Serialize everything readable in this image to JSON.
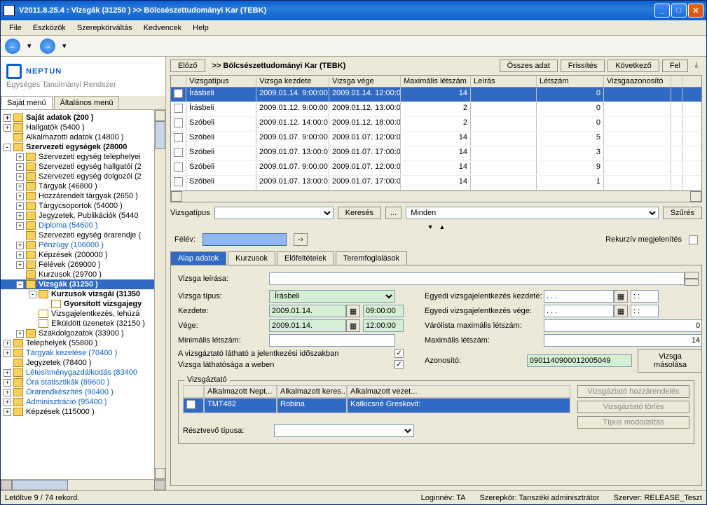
{
  "title": "V2011.8.25.4 : Vizsgák (31250  )   >> Bölcsészettudományi Kar (TEBK)",
  "menu": [
    "File",
    "Eszközök",
    "Szerepkörváltás",
    "Kedvencek",
    "Help"
  ],
  "logo": {
    "brand": "NEPTUN",
    "sub": "Egységes Tanulmányi Rendszer"
  },
  "left_tabs": {
    "active": "Saját menü",
    "other": "Általános menü"
  },
  "tree": [
    {
      "l": 1,
      "exp": "+",
      "bold": true,
      "t": "Saját adatok (200  )"
    },
    {
      "l": 1,
      "exp": "+",
      "t": "Hallgatók (5400  )"
    },
    {
      "l": 1,
      "exp": " ",
      "t": "Alkalmazotti adatok (14800  )"
    },
    {
      "l": 1,
      "exp": "-",
      "bold": true,
      "t": "Szervezeti egységek (28000"
    },
    {
      "l": 2,
      "exp": "+",
      "t": "Szervezeti egység telephelyei"
    },
    {
      "l": 2,
      "exp": "+",
      "t": "Szervezeti egység hallgatói (2"
    },
    {
      "l": 2,
      "exp": "+",
      "t": "Szervezeti egység dolgozói (2"
    },
    {
      "l": 2,
      "exp": "+",
      "t": "Tárgyak (46800  )"
    },
    {
      "l": 2,
      "exp": "+",
      "t": "Hozzárendelt tárgyak (2650  )"
    },
    {
      "l": 2,
      "exp": "+",
      "t": "Tárgycsoportok (54000  )"
    },
    {
      "l": 2,
      "exp": "+",
      "t": "Jegyzetek, Publikációk (5440"
    },
    {
      "l": 2,
      "exp": "+",
      "blue": true,
      "t": "Diploma (54600  )"
    },
    {
      "l": 2,
      "exp": " ",
      "t": "Szervezeti egység órarendje ("
    },
    {
      "l": 2,
      "exp": "+",
      "blue": true,
      "t": "Pénzügy (106000  )"
    },
    {
      "l": 2,
      "exp": "+",
      "t": "Képzések (200000  )"
    },
    {
      "l": 2,
      "exp": "+",
      "t": "Félévek (269000  )"
    },
    {
      "l": 2,
      "exp": " ",
      "t": "Kurzusok (29700  )"
    },
    {
      "l": 2,
      "exp": "-",
      "sel": true,
      "bold": true,
      "t": "Vizsgák (31250  )"
    },
    {
      "l": 3,
      "exp": "-",
      "bold": true,
      "t": "Kurzusok vizsgái (31350"
    },
    {
      "l": 4,
      "exp": " ",
      "bold": true,
      "doc": true,
      "t": "Gyorsított vizsgajegy"
    },
    {
      "l": 3,
      "exp": " ",
      "doc": true,
      "t": "Vizsgajelentkezés, lehúzá"
    },
    {
      "l": 3,
      "exp": " ",
      "doc": true,
      "t": "Elküldött üzenetek (32150  )"
    },
    {
      "l": 2,
      "exp": "+",
      "t": "Szakdolgozatok (33900  )"
    },
    {
      "l": 1,
      "exp": "+",
      "t": "Telephelyek (55800  )"
    },
    {
      "l": 1,
      "exp": "+",
      "blue": true,
      "t": "Tárgyak kezelése (70400  )"
    },
    {
      "l": 1,
      "exp": " ",
      "t": "Jegyzetek (78400  )"
    },
    {
      "l": 1,
      "exp": "+",
      "blue": true,
      "t": "Létesítménygazdálkodás (83400"
    },
    {
      "l": 1,
      "exp": "+",
      "blue": true,
      "t": "Óra statisztikák (89600  )"
    },
    {
      "l": 1,
      "exp": "+",
      "blue": true,
      "t": "Órarendkészítés (90400  )"
    },
    {
      "l": 1,
      "exp": "+",
      "blue": true,
      "t": "Adminisztráció (95400  )"
    },
    {
      "l": 1,
      "exp": "+",
      "t": "Képzések (115000  )"
    }
  ],
  "bc": {
    "prev": "Előző",
    "path": ">>  Bölcsészettudományi Kar (TEBK)",
    "all": "Összes adat",
    "refresh": "Frissítés",
    "next": "Következő",
    "up": "Fel"
  },
  "grid": {
    "head": [
      "",
      "Vizsgatípus",
      "Vizsga kezdete",
      "Vizsga vége",
      "Maximális létszám",
      "Leírás",
      "Létszám",
      "Vizsgaazonosító"
    ],
    "rows": [
      {
        "sel": true,
        "typ": "Írásbeli",
        "kez": "2009.01.14. 9:00:00",
        "veg": "2009.01.14. 12:00:0",
        "max": "14",
        "lei": "",
        "let": "0",
        "azo": ""
      },
      {
        "typ": "Írásbeli",
        "kez": "2009.01.12. 9:00:00",
        "veg": "2009.01.12. 13:00:0",
        "max": "2",
        "lei": "",
        "let": "0",
        "azo": ""
      },
      {
        "typ": "Szóbeli",
        "kez": "2009.01.12. 14:00:0",
        "veg": "2009.01.12. 18:00:0",
        "max": "2",
        "lei": "",
        "let": "0",
        "azo": ""
      },
      {
        "typ": "Szóbeli",
        "kez": "2009.01.07. 9:00:00",
        "veg": "2009.01.07. 12:00:0",
        "max": "14",
        "lei": "",
        "let": "5",
        "azo": ""
      },
      {
        "typ": "Szóbeli",
        "kez": "2009.01.07. 13:00:0",
        "veg": "2009.01.07. 17:00:0",
        "max": "14",
        "lei": "",
        "let": "3",
        "azo": ""
      },
      {
        "typ": "Szóbeli",
        "kez": "2009.01.07. 9:00:00",
        "veg": "2009.01.07. 12:00:0",
        "max": "14",
        "lei": "",
        "let": "9",
        "azo": ""
      },
      {
        "typ": "Szóbeli",
        "kez": "2009.01.07. 13:00:0",
        "veg": "2009.01.07. 17:00:0",
        "max": "14",
        "lei": "",
        "let": "1",
        "azo": ""
      }
    ]
  },
  "filter": {
    "label": "Vizsgatípus",
    "search": "Keresés",
    "all": "Minden",
    "btn": "Szűrés",
    "dots": "..."
  },
  "felev": {
    "label": "Félév:",
    "rec": "Rekurzív megjelenítés"
  },
  "dtabs": [
    "Alap adatok",
    "Kurzusok",
    "Előfeltételek",
    "Teremfoglalások"
  ],
  "detail": {
    "desc_l": "Vizsga leírása:",
    "typ_l": "Vizsga típus:",
    "typ_v": "Írásbeli",
    "kez_l": "Kezdete:",
    "kez_d": "2009.01.14.",
    "kez_t": "09:00:00",
    "veg_l": "Vége:",
    "veg_d": "2009.01.14.",
    "veg_t": "12:00:00",
    "min_l": "Minimális létszám:",
    "vlw_l": "A vizsgáztató látható a jelentkezési időszakban",
    "vwe_l": "Vizsga láthatósága a weben",
    "ek_l": "Egyedi vizsgajelentkezés kezdete:",
    "ek_d": ". . .",
    "ek_t": ": :",
    "ev_l": "Egyedi vizsgajelentkezés vége:",
    "ev_d": ". . .",
    "ev_t": ": :",
    "var_l": "Várólista maximális létszám:",
    "var_v": "0",
    "max_l": "Maximális létszám:",
    "max_v": "14",
    "azo_l": "Azonosító:",
    "azo_v": "0901140900012005049",
    "copy": "Vizsga másolása",
    "grp": "Vizsgáztató",
    "ihead": [
      "",
      "Alkalmazott Nept...",
      "Alkalmazott keres...",
      "Alkalmazott vezet..."
    ],
    "irow": {
      "a": "TMT482",
      "b": "Robina",
      "c": "Katkicsné Greskovit:"
    },
    "sb": [
      "Vizsgáztató hozzárendelés",
      "Vizsgáztató törlés",
      "Típus mododsítás"
    ],
    "rt_l": "Résztvevő típusa:"
  },
  "status": {
    "left": "Letöltve 9 / 74 rekord.",
    "login": "Loginnév: TA",
    "role": "Szerepkör: Tanszéki adminisztrátor",
    "srv": "Szerver: RELEASE_Teszt"
  }
}
